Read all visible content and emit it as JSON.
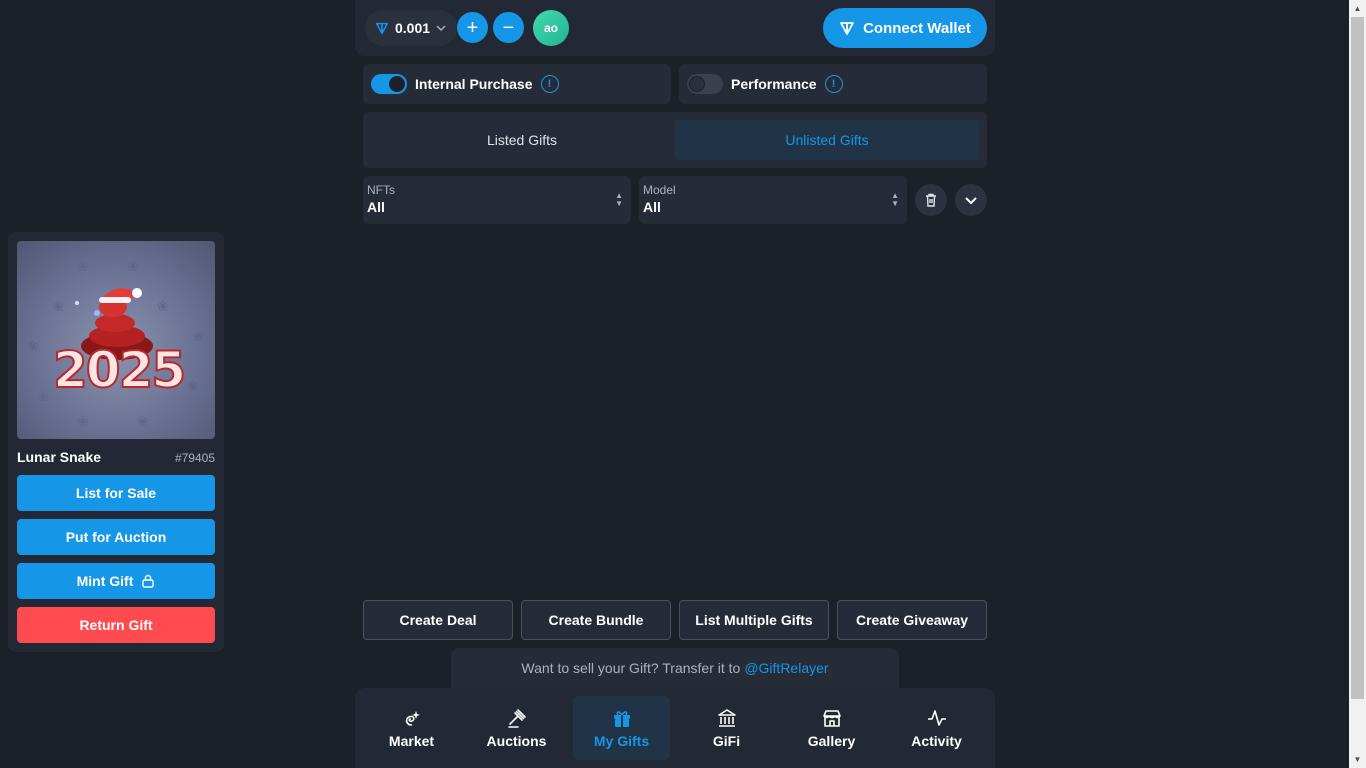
{
  "header": {
    "ton_amount": "0.001",
    "avatar_initials": "ao",
    "connect_label": "Connect Wallet",
    "plus_label": "+",
    "minus_label": "−"
  },
  "toggles": {
    "internal_purchase": {
      "label": "Internal Purchase",
      "on": true
    },
    "performance": {
      "label": "Performance",
      "on": false
    },
    "info_glyph": "!"
  },
  "tabs": {
    "listed": "Listed Gifts",
    "unlisted": "Unlisted Gifts",
    "active": "unlisted"
  },
  "filters": {
    "nfts": {
      "label": "NFTs",
      "value": "All"
    },
    "model": {
      "label": "Model",
      "value": "All"
    }
  },
  "gift_card": {
    "name": "Lunar Snake",
    "number": "#79405",
    "image_text": "2025",
    "buttons": {
      "list_for_sale": "List for Sale",
      "put_for_auction": "Put for Auction",
      "mint_gift": "Mint Gift",
      "return_gift": "Return Gift"
    }
  },
  "actions": {
    "create_deal": "Create Deal",
    "create_bundle": "Create Bundle",
    "list_multiple": "List Multiple Gifts",
    "create_giveaway": "Create Giveaway"
  },
  "relay": {
    "text": "Want to sell your Gift? Transfer it to",
    "link": "@GiftRelayer"
  },
  "nav": {
    "market": "Market",
    "auctions": "Auctions",
    "my_gifts": "My Gifts",
    "gifi": "GiFi",
    "gallery": "Gallery",
    "activity": "Activity",
    "active": "my_gifts"
  },
  "colors": {
    "accent": "#1696e6",
    "danger": "#ff4a50",
    "background": "#1c2029",
    "panel": "#232934"
  }
}
